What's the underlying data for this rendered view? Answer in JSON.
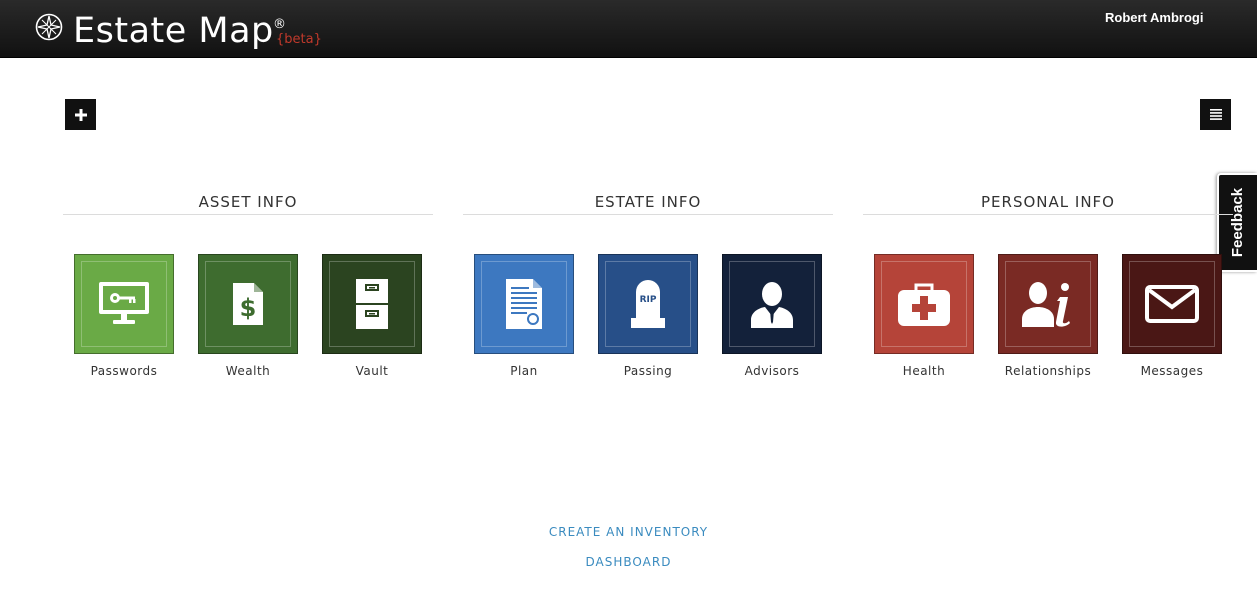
{
  "header": {
    "brand": "Estate Map",
    "registered": "®",
    "beta": "{beta}",
    "user": "Robert Ambrogi"
  },
  "toolbar": {
    "add_icon": "plus-icon",
    "menu_icon": "list-icon"
  },
  "feedback_label": "Feedback",
  "sections": [
    {
      "title": "ASSET INFO",
      "tiles": [
        {
          "label": "Passwords",
          "icon": "monitor-key-icon",
          "color": "#6aaa46"
        },
        {
          "label": "Wealth",
          "icon": "dollar-document-icon",
          "color": "#3e6c2f"
        },
        {
          "label": "Vault",
          "icon": "file-cabinet-icon",
          "color": "#2b4420"
        }
      ]
    },
    {
      "title": "ESTATE INFO",
      "tiles": [
        {
          "label": "Plan",
          "icon": "certificate-document-icon",
          "color": "#3d78c0"
        },
        {
          "label": "Passing",
          "icon": "tombstone-icon",
          "color": "#274f88"
        },
        {
          "label": "Advisors",
          "icon": "person-suit-icon",
          "color": "#13213a"
        }
      ]
    },
    {
      "title": "PERSONAL INFO",
      "tiles": [
        {
          "label": "Health",
          "icon": "first-aid-kit-icon",
          "color": "#b54439"
        },
        {
          "label": "Relationships",
          "icon": "person-info-icon",
          "color": "#7a2a24"
        },
        {
          "label": "Messages",
          "icon": "envelope-icon",
          "color": "#4a1715"
        }
      ]
    }
  ],
  "links": {
    "create_inventory": "CREATE AN INVENTORY",
    "dashboard": "DASHBOARD"
  }
}
